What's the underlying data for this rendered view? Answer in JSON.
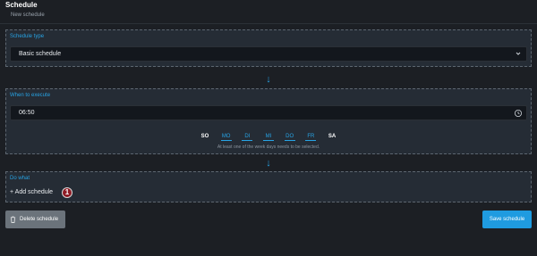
{
  "header": {
    "title": "Schedule",
    "subtitle": "New schedule"
  },
  "schedule_type": {
    "title": "Schedule type",
    "selected": "Basic schedule"
  },
  "when": {
    "title": "When to execute",
    "time": "06:50",
    "days": [
      {
        "label": "SO",
        "selected": false
      },
      {
        "label": "MO",
        "selected": true
      },
      {
        "label": "DI",
        "selected": true
      },
      {
        "label": "MI",
        "selected": true
      },
      {
        "label": "DO",
        "selected": true
      },
      {
        "label": "FR",
        "selected": true
      },
      {
        "label": "SA",
        "selected": false
      }
    ],
    "hint": "At least one of the week days needs to be selected."
  },
  "do_what": {
    "title": "Do what",
    "add_label": "+ Add schedule",
    "badge": "1"
  },
  "footer": {
    "delete_label": "Delete schedule",
    "save_label": "Save schedule"
  },
  "icons": {
    "arrow": "arrow-down-icon",
    "chevron": "chevron-down-icon",
    "clock": "clock-icon",
    "trash": "trash-icon"
  },
  "colors": {
    "accent": "#27a3e4",
    "background": "#1c1f24",
    "panel": "#252c35",
    "save_button": "#1f9be0",
    "delete_button": "#6b737b",
    "badge": "#8f1b24"
  }
}
